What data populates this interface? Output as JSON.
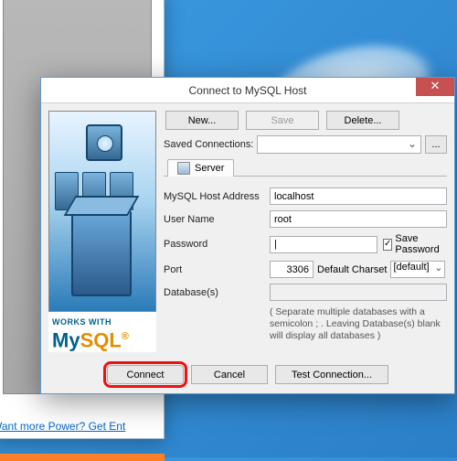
{
  "bg_link": "Want more Power? Get Ent",
  "dialog": {
    "title": "Connect to MySQL Host",
    "close_glyph": "✕",
    "buttons": {
      "new": "New...",
      "save": "Save",
      "delete": "Delete..."
    },
    "saved_label": "Saved Connections:",
    "browse_btn": "...",
    "tab_server": "Server",
    "fields": {
      "host_label": "MySQL Host Address",
      "host_value": "localhost",
      "user_label": "User Name",
      "user_value": "root",
      "password_label": "Password",
      "password_value": "|",
      "save_pw_label": "Save Password",
      "save_pw_checked": "✓",
      "port_label": "Port",
      "port_value": "3306",
      "charset_label": "Default Charset",
      "charset_value": "[default]",
      "dbs_label": "Database(s)",
      "dbs_value": ""
    },
    "hint": "( Separate multiple databases with a semicolon ; . Leaving Database(s) blank will display all databases )",
    "footer": {
      "connect": "Connect",
      "cancel": "Cancel",
      "test": "Test Connection..."
    },
    "logo": {
      "works": "WORKS WITH",
      "my": "My",
      "sql": "SQL"
    }
  }
}
